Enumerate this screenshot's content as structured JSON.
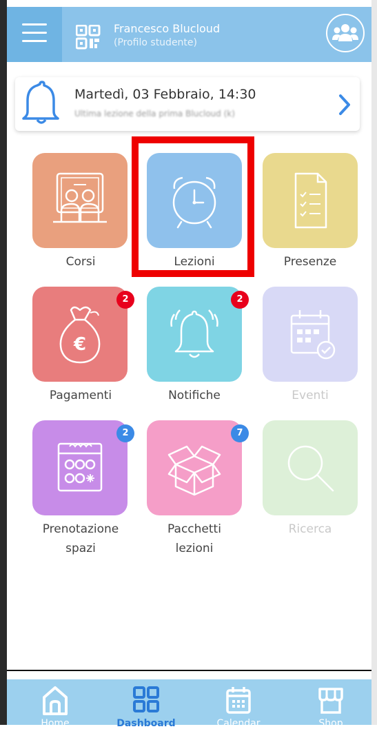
{
  "header": {
    "name": "Francesco Blucloud",
    "subtitle": "(Profilo studente)",
    "icons": [
      "menu-icon",
      "qr-code-icon",
      "group-icon"
    ]
  },
  "notice": {
    "date": "Martedì, 03 Febbraio, 14:30",
    "subtitle": "Ultima lezione della prima Blucloud (k)",
    "icons": [
      "bell-icon",
      "chevron-right-icon"
    ]
  },
  "tiles": [
    {
      "label": "Corsi",
      "color": "#e9a07e",
      "icon": "classroom-icon",
      "enabled": true
    },
    {
      "label": "Lezioni",
      "color": "#8fc1ec",
      "icon": "alarm-clock-icon",
      "enabled": true
    },
    {
      "label": "Presenze",
      "color": "#e9d98e",
      "icon": "checklist-icon",
      "enabled": true
    },
    {
      "label": "Pagamenti",
      "color": "#e87d7d",
      "icon": "money-bag-icon",
      "enabled": true,
      "badge": "2",
      "badge_color": "#e8001c"
    },
    {
      "label": "Notifiche",
      "color": "#7fd4e4",
      "icon": "ringing-bell-icon",
      "enabled": true,
      "badge": "2",
      "badge_color": "#e8001c"
    },
    {
      "label": "Eventi",
      "color": "#d8d9f6",
      "icon": "calendar-check-icon",
      "enabled": false
    },
    {
      "label": "Prenotazione spazi",
      "line1": "Prenotazione",
      "line2": "spazi",
      "color": "#c78ce8",
      "icon": "calendar-grid-icon",
      "enabled": true,
      "badge": "2",
      "badge_color": "#3b8ae6"
    },
    {
      "label": "Pacchetti lezioni",
      "line1": "Pacchetti",
      "line2": "lezioni",
      "color": "#f59ec8",
      "icon": "package-icon",
      "enabled": true,
      "badge": "7",
      "badge_color": "#3b8ae6"
    },
    {
      "label": "Ricerca",
      "color": "#ddf0d8",
      "icon": "search-icon",
      "enabled": false
    }
  ],
  "bottom_nav": [
    {
      "label": "Home",
      "icon": "home-icon",
      "active": false
    },
    {
      "label": "Dashboard",
      "icon": "dashboard-icon",
      "active": true
    },
    {
      "label": "Calendar",
      "icon": "calendar-icon",
      "active": false
    },
    {
      "label": "Shop",
      "icon": "shop-icon",
      "active": false
    }
  ],
  "colors": {
    "header": "#8bc3ea",
    "bottom_bar": "#9cd0ee",
    "highlight": "#ee0000"
  }
}
